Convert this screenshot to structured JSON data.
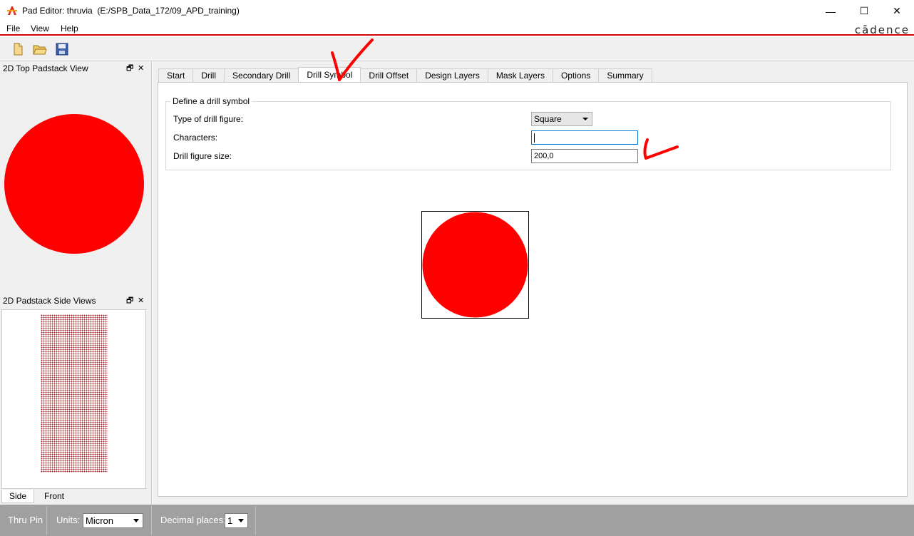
{
  "window": {
    "title": "Pad Editor: thruvia  (E:/SPB_Data_172/09_APD_training)",
    "minimize": "—",
    "maximize": "☐",
    "close": "✕"
  },
  "menu": {
    "items": [
      "File",
      "View",
      "Help"
    ],
    "brand": "cādence"
  },
  "toolbar": {
    "buttons": [
      "new-file-icon",
      "open-folder-icon",
      "save-icon"
    ]
  },
  "left_panel": {
    "top_view_title": "2D Top Padstack View",
    "side_view_title": "2D Padstack Side Views",
    "float_glyph": "🗗",
    "close_glyph": "✕",
    "side_tabs": [
      "Side",
      "Front"
    ],
    "pad_color": "#ff0000"
  },
  "tabs": [
    "Start",
    "Drill",
    "Secondary Drill",
    "Drill Symbol",
    "Drill Offset",
    "Design Layers",
    "Mask Layers",
    "Options",
    "Summary"
  ],
  "active_tab": "Drill Symbol",
  "drill_symbol": {
    "group_title": "Define a drill symbol",
    "type_label": "Type of drill figure:",
    "type_value": "Square",
    "characters_label": "Characters:",
    "characters_value": "",
    "size_label": "Drill figure size:",
    "size_value": "200,0"
  },
  "statusbar": {
    "mode": "Thru Pin",
    "units_label": "Units:",
    "units_value": "Micron",
    "decimal_label": "Decimal places:",
    "decimal_value": "1"
  },
  "colors": {
    "accent_red": "#ff0000",
    "menu_underline": "#d00000",
    "statusbar": "#a0a0a0"
  }
}
